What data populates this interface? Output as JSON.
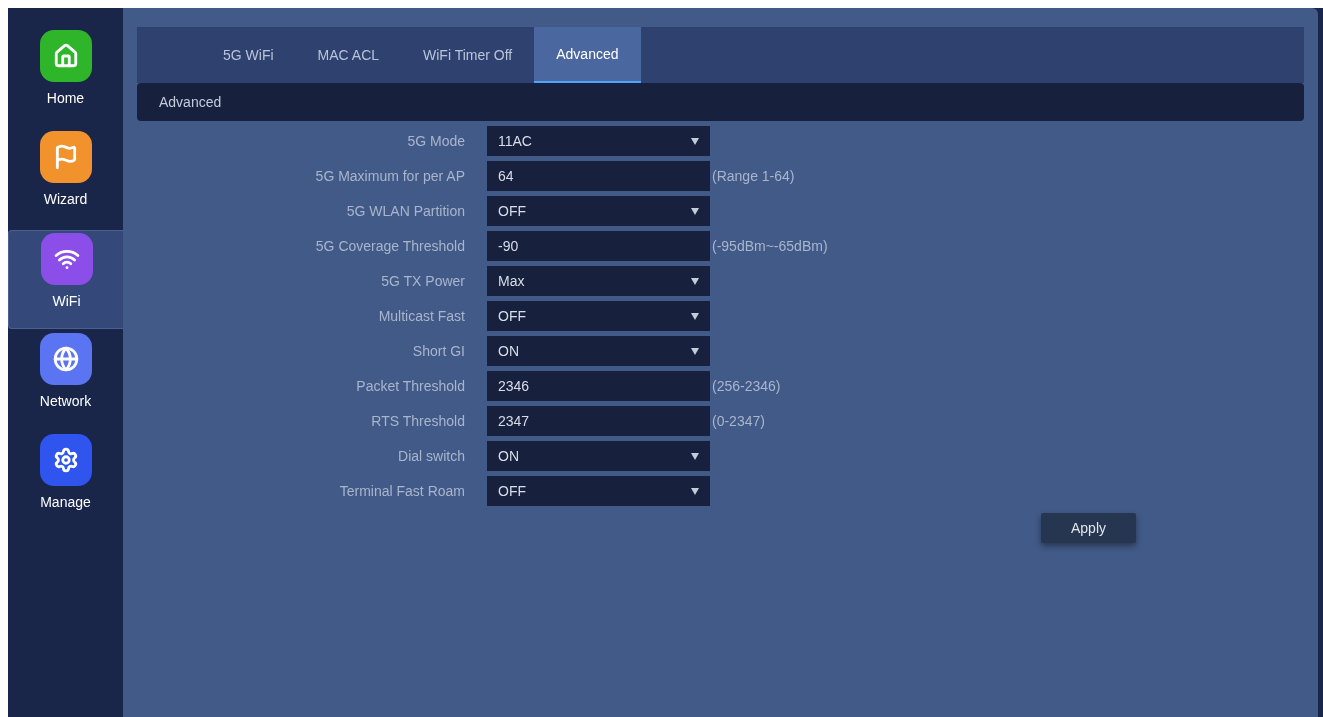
{
  "sidebar": {
    "items": [
      {
        "label": "Home",
        "kind": "home",
        "selected": false
      },
      {
        "label": "Wizard",
        "kind": "wizard",
        "selected": false
      },
      {
        "label": "WiFi",
        "kind": "wifi",
        "selected": true
      },
      {
        "label": "Network",
        "kind": "network",
        "selected": false
      },
      {
        "label": "Manage",
        "kind": "manage",
        "selected": false
      }
    ]
  },
  "tabs": [
    {
      "label": "5G WiFi",
      "selected": false
    },
    {
      "label": "MAC ACL",
      "selected": false
    },
    {
      "label": "WiFi Timer Off",
      "selected": false
    },
    {
      "label": "Advanced",
      "selected": true
    }
  ],
  "section": {
    "title": "Advanced"
  },
  "fields": [
    {
      "label": "5G Mode",
      "kind": "select",
      "value": "11AC"
    },
    {
      "label": "5G Maximum for per AP",
      "kind": "input",
      "value": "64",
      "hint": "(Range 1-64)"
    },
    {
      "label": "5G WLAN Partition",
      "kind": "select",
      "value": "OFF"
    },
    {
      "label": "5G Coverage Threshold",
      "kind": "input",
      "value": "-90",
      "hint": "(-95dBm~-65dBm)"
    },
    {
      "label": "5G TX Power",
      "kind": "select",
      "value": "Max"
    },
    {
      "label": "Multicast Fast",
      "kind": "select",
      "value": "OFF"
    },
    {
      "label": "Short GI",
      "kind": "select",
      "value": "ON"
    },
    {
      "label": "Packet Threshold",
      "kind": "input",
      "value": "2346",
      "hint": "(256-2346)"
    },
    {
      "label": "RTS Threshold",
      "kind": "input",
      "value": "2347",
      "hint": "(0-2347)"
    },
    {
      "label": "Dial switch",
      "kind": "select",
      "value": "ON"
    },
    {
      "label": "Terminal Fast Roam",
      "kind": "select",
      "value": "OFF"
    }
  ],
  "buttons": [
    {
      "label": "Apply"
    }
  ]
}
